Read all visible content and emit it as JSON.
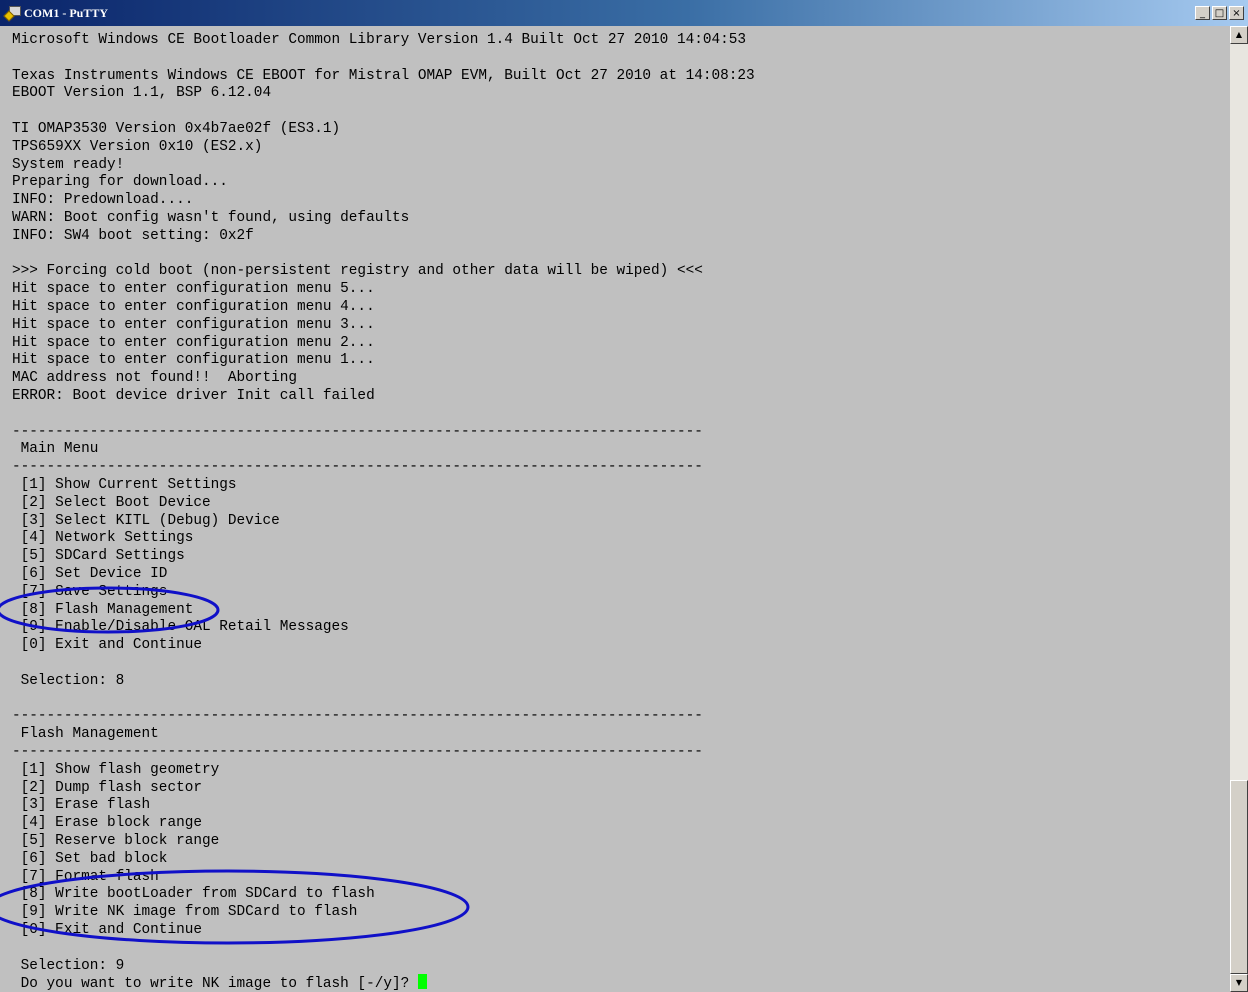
{
  "window": {
    "title": "COM1 - PuTTY",
    "minimize_label": "_",
    "maximize_label": "□",
    "close_label": "×"
  },
  "terminal": {
    "lines": [
      "Microsoft Windows CE Bootloader Common Library Version 1.4 Built Oct 27 2010 14:04:53",
      "",
      "Texas Instruments Windows CE EBOOT for Mistral OMAP EVM, Built Oct 27 2010 at 14:08:23",
      "EBOOT Version 1.1, BSP 6.12.04",
      "",
      "TI OMAP3530 Version 0x4b7ae02f (ES3.1)",
      "TPS659XX Version 0x10 (ES2.x)",
      "System ready!",
      "Preparing for download...",
      "INFO: Predownload....",
      "WARN: Boot config wasn't found, using defaults",
      "INFO: SW4 boot setting: 0x2f",
      "",
      ">>> Forcing cold boot (non-persistent registry and other data will be wiped) <<<",
      "Hit space to enter configuration menu 5...",
      "Hit space to enter configuration menu 4...",
      "Hit space to enter configuration menu 3...",
      "Hit space to enter configuration menu 2...",
      "Hit space to enter configuration menu 1...",
      "MAC address not found!!  Aborting",
      "ERROR: Boot device driver Init call failed",
      "",
      "--------------------------------------------------------------------------------",
      " Main Menu",
      "--------------------------------------------------------------------------------",
      " [1] Show Current Settings",
      " [2] Select Boot Device",
      " [3] Select KITL (Debug) Device",
      " [4] Network Settings",
      " [5] SDCard Settings",
      " [6] Set Device ID",
      " [7] Save Settings",
      " [8] Flash Management",
      " [9] Enable/Disable OAL Retail Messages",
      " [0] Exit and Continue",
      "",
      " Selection: 8",
      "",
      "--------------------------------------------------------------------------------",
      " Flash Management",
      "--------------------------------------------------------------------------------",
      " [1] Show flash geometry",
      " [2] Dump flash sector",
      " [3] Erase flash",
      " [4] Erase block range",
      " [5] Reserve block range",
      " [6] Set bad block",
      " [7] Format flash",
      " [8] Write bootLoader from SDCard to flash",
      " [9] Write NK image from SDCard to flash",
      " [0] Exit and Continue",
      "",
      " Selection: 9",
      " Do you want to write NK image to flash [-/y]? "
    ]
  },
  "colors": {
    "terminal_bg": "#c0c0c0",
    "terminal_fg": "#000000",
    "cursor": "#00ff00",
    "annotation": "#1010c8"
  },
  "icons": {
    "app": "putty-icon",
    "scroll_up": "scroll-up-arrow-icon",
    "scroll_down": "scroll-down-arrow-icon"
  }
}
